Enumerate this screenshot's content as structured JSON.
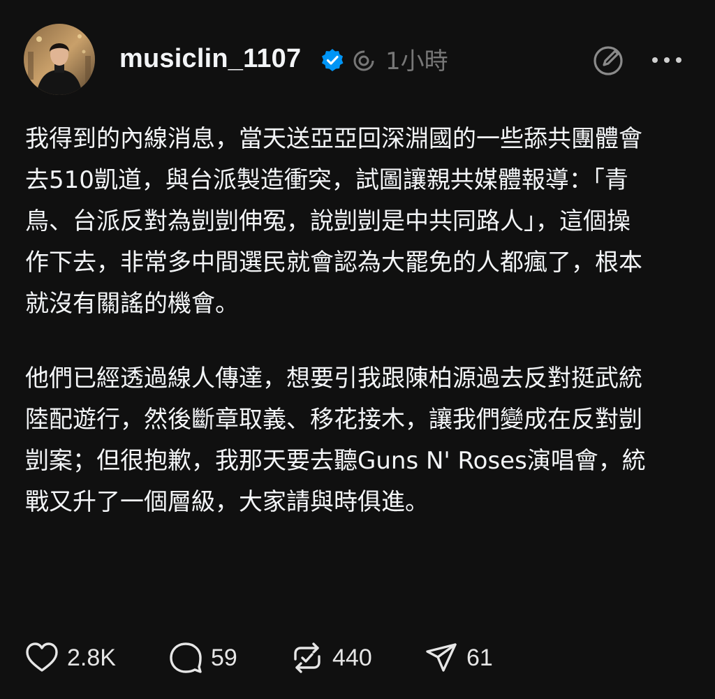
{
  "post": {
    "username": "musiclin_1107",
    "time": "1小時",
    "paragraphs": [
      "我得到的內線消息，當天送亞亞回深淵國的一些舔共團體會去510凱道，與台派製造衝突，試圖讓親共媒體報導：「青鳥、台派反對為剴剴伸冤，說剴剴是中共同路人」，這個操作下去，非常多中間選民就會認為大罷免的人都瘋了，根本就沒有關謠的機會。",
      "他們已經透過線人傳達，想要引我跟陳柏源過去反對挺武統陸配遊行，然後斷章取義、移花接木，讓我們變成在反對剴剴案；但很抱歉，我那天要去聽Guns N' Roses演唱會，統戰又升了一個層級，大家請與時俱進。"
    ],
    "actions": {
      "likes": "2.8K",
      "replies": "59",
      "reposts": "440",
      "shares": "61"
    }
  },
  "icons": {
    "verified": "verified-badge-icon",
    "thread": "thread-spiral-icon",
    "compose": "compose-icon",
    "more": "more-icon",
    "like": "heart-icon",
    "reply": "comment-icon",
    "repost": "repost-icon",
    "share": "send-icon"
  },
  "colors": {
    "background": "#101010",
    "text": "#f3f5f7",
    "muted": "#777777",
    "verified": "#0095f6"
  }
}
